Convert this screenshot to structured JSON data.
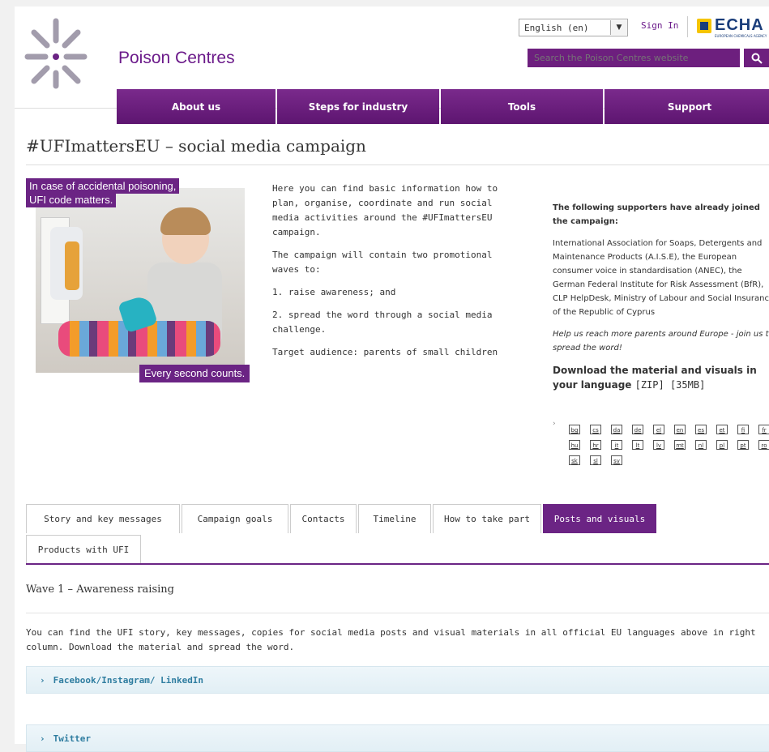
{
  "header": {
    "site_name": "Poison Centres",
    "language_selected": "English (en)",
    "sign_in": "Sign In",
    "echa_logo_text": "ECHA",
    "echa_logo_sub": "EUROPEAN CHEMICALS AGENCY",
    "search_placeholder": "Search the Poison Centres website",
    "colors": {
      "brand_purple": "#6b2484",
      "nav_purple": "#6d1f7e",
      "echa_blue": "#1a3d7a"
    }
  },
  "nav": {
    "items": [
      {
        "label": "About us"
      },
      {
        "label": "Steps for industry"
      },
      {
        "label": "Tools"
      },
      {
        "label": "Support"
      }
    ]
  },
  "page": {
    "title": "#UFImattersEU – social media campaign"
  },
  "hero": {
    "caption_line1": "In case of accidental poisoning,",
    "caption_line2": "UFI code matters.",
    "caption_bottom": "Every second counts."
  },
  "intro": {
    "p1": "Here you can find basic information how to plan, organise, coordinate and run social media activities around the #UFImattersEU campaign.",
    "p2": "The campaign will contain two promotional waves to:",
    "p3": "1. raise awareness; and",
    "p4": "2. spread the word through a social media challenge.",
    "p5": "Target audience: parents of small children"
  },
  "supporters": {
    "heading": "The following supporters have already joined the campaign:",
    "list": "International Association for Soaps, Detergents and Maintenance Products (A.I.S.E), the European consumer voice in standardisation (ANEC), the German Federal Institute for Risk Assessment (BfR), CLP HelpDesk, Ministry of Labour and Social Insurance of the Republic of Cyprus",
    "help": "Help us reach more parents around Europe - join us to spread the word!",
    "download_heading": "Download the material and visuals in your language",
    "download_meta": "[ZIP] [35MB]",
    "languages": [
      "bg",
      "cs",
      "da",
      "de",
      "el",
      "en",
      "es",
      "et",
      "fi",
      "fr",
      "hu",
      "hr",
      "it",
      "lt",
      "lv",
      "mt",
      "nl",
      "pl",
      "pt",
      "ro",
      "sk",
      "sl",
      "sv"
    ]
  },
  "tabs": {
    "items": [
      {
        "label": "Story and key messages"
      },
      {
        "label": "Campaign goals"
      },
      {
        "label": "Contacts"
      },
      {
        "label": "Timeline"
      },
      {
        "label": "How to take part"
      },
      {
        "label": "Posts and visuals",
        "active": true
      },
      {
        "label": "Products with UFI"
      }
    ]
  },
  "content": {
    "wave_title": "Wave 1 – Awareness raising",
    "wave_text": "You can find the UFI story, key messages, copies for social media posts and visual materials in all official EU languages above in right column. Download the material and spread the word.",
    "accordions": [
      {
        "label": "Facebook/Instagram/ LinkedIn"
      },
      {
        "label": "Twitter"
      }
    ]
  }
}
